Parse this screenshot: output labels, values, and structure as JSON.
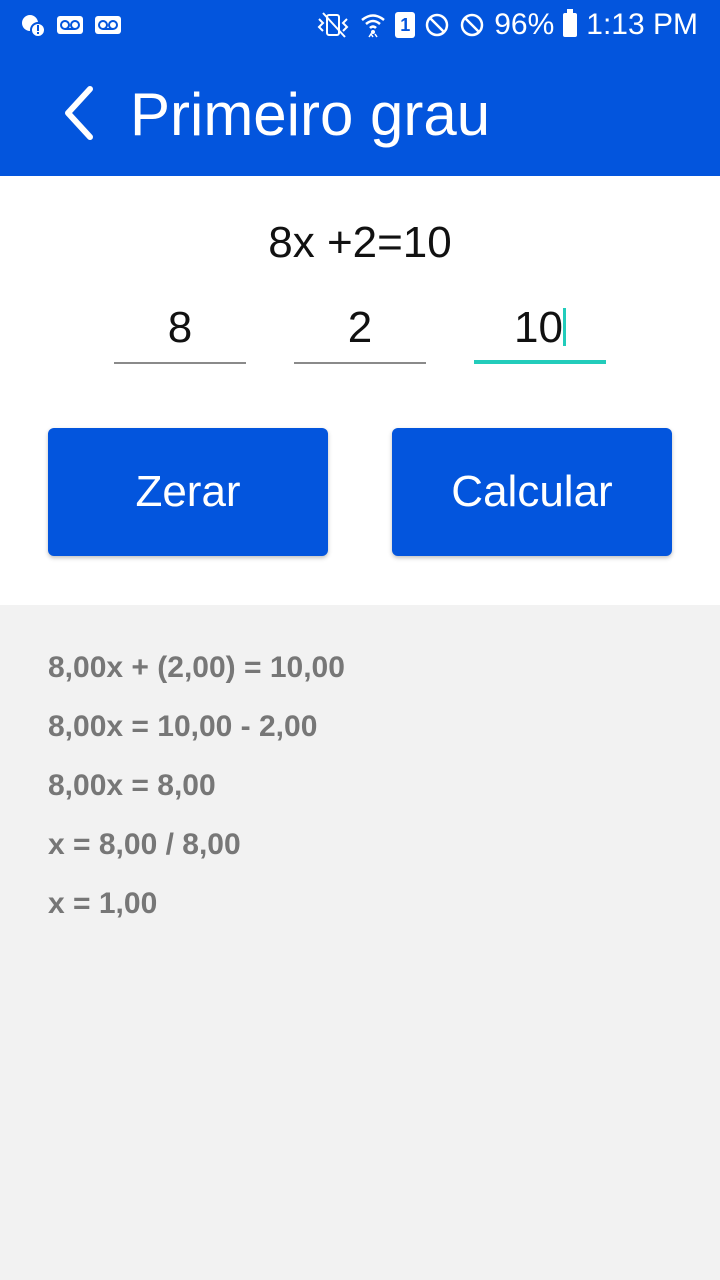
{
  "status_bar": {
    "battery": "96%",
    "time": "1:13 PM",
    "sim": "1",
    "icons": [
      "notification-icon",
      "voicemail-icon",
      "voicemail-icon",
      "vibrate-icon",
      "wifi-icon",
      "sim-icon",
      "blocked-icon",
      "blocked-icon",
      "battery-icon"
    ]
  },
  "appbar": {
    "title": "Primeiro grau",
    "back_icon": "chevron-left-icon"
  },
  "equation": "8x +2=10",
  "inputs": {
    "a": "8",
    "b": "2",
    "c": "10"
  },
  "buttons": {
    "reset": "Zerar",
    "calculate": "Calcular"
  },
  "steps": [
    "8,00x + (2,00) = 10,00",
    "8,00x = 10,00 - 2,00",
    "8,00x = 8,00",
    "x = 8,00 / 8,00",
    "x = 1,00"
  ],
  "colors": {
    "primary": "#0355dd",
    "accent": "#22ccbb",
    "result_text": "#777777",
    "background": "#f2f2f2"
  }
}
